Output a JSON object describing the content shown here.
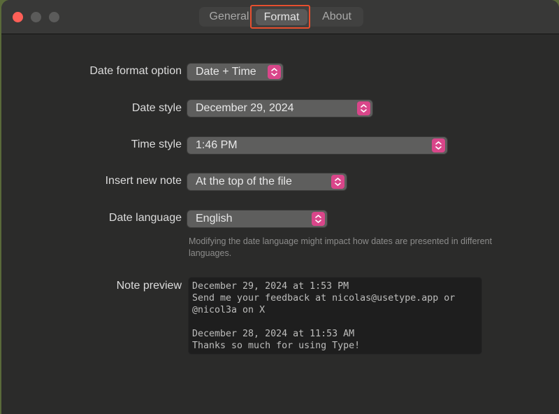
{
  "window": {
    "traffic_lights": [
      "close",
      "minimize",
      "zoom"
    ]
  },
  "tabs": [
    {
      "label": "General",
      "selected": false
    },
    {
      "label": "Format",
      "selected": true
    },
    {
      "label": "About",
      "selected": false
    }
  ],
  "settings": {
    "date_format_option": {
      "label": "Date format option",
      "value": "Date + Time"
    },
    "date_style": {
      "label": "Date style",
      "value": "December 29, 2024"
    },
    "time_style": {
      "label": "Time style",
      "value": "1:46 PM"
    },
    "insert_new_note": {
      "label": "Insert new note",
      "value": "At the top of the file"
    },
    "date_language": {
      "label": "Date language",
      "value": "English",
      "hint": "Modifying the date language might impact how dates are presented in different languages."
    }
  },
  "note_preview": {
    "label": "Note preview",
    "text": "December 29, 2024 at 1:53 PM\nSend me your feedback at nicolas@usetype.app or\n@nicol3a on X\n\nDecember 28, 2024 at 11:53 AM\nThanks so much for using Type!"
  },
  "colors": {
    "accent": "#d9468a",
    "highlight": "#e8502f",
    "close": "#fe5f57"
  }
}
